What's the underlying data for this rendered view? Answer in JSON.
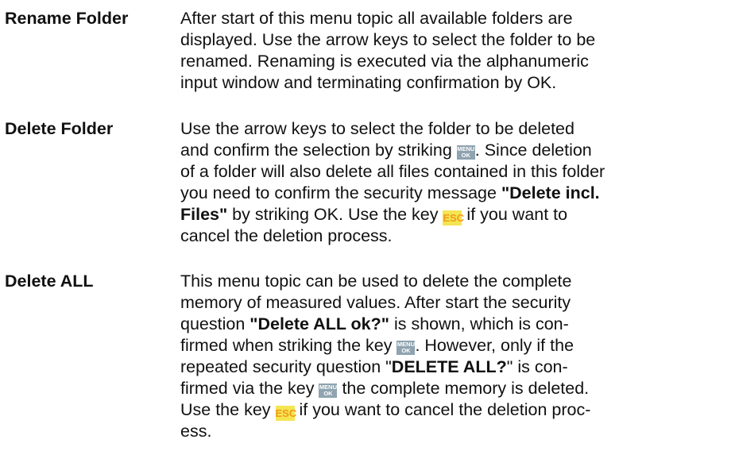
{
  "entries": [
    {
      "term": "Rename Folder",
      "lines": [
        [
          "After start of this menu topic all available folders are"
        ],
        [
          "displayed. Use the arrow keys to select the folder to be"
        ],
        [
          "renamed. Renaming is executed via the alphanumeric"
        ],
        [
          "input window and terminating confirmation by OK."
        ]
      ]
    },
    {
      "term": "Delete Folder",
      "lines": [
        [
          "Use the arrow keys to select the folder to be deleted"
        ],
        [
          "and confirm the selection by striking ",
          "MENU/OK-KEY",
          ". Since deletion"
        ],
        [
          "of a folder will also delete all files contained in this folder"
        ],
        [
          "you need to confirm the security message ",
          "\"Delete incl."
        ],
        [
          "Files\"",
          " by striking OK. Use the key ",
          "ESC-KEY",
          " if you want to"
        ],
        [
          "cancel the deletion process."
        ]
      ]
    },
    {
      "term": "Delete ALL",
      "lines": [
        [
          "This menu topic can be used to delete the complete"
        ],
        [
          "memory of measured values. After start the security"
        ],
        [
          "question ",
          "\"Delete ALL ok?\"",
          " is shown, which is con-"
        ],
        [
          "firmed when striking the key ",
          "MENU/OK-KEY",
          ". However, only if the"
        ],
        [
          "repeated security question \"",
          "DELETE ALL?",
          "\" is con-"
        ],
        [
          "firmed via the key ",
          "MENU/OK-KEY",
          " the complete memory is deleted."
        ],
        [
          "Use the key ",
          "ESC-KEY",
          " if you want to cancel the deletion proc-"
        ],
        [
          "ess."
        ]
      ]
    }
  ],
  "keys": {
    "menu_top": "MENU",
    "menu_bottom": "OK",
    "esc": "ESC",
    "menu_color": "#8fa3b0",
    "esc_bg_color": "#f4e552",
    "esc_text_color": "#f19a1a"
  }
}
